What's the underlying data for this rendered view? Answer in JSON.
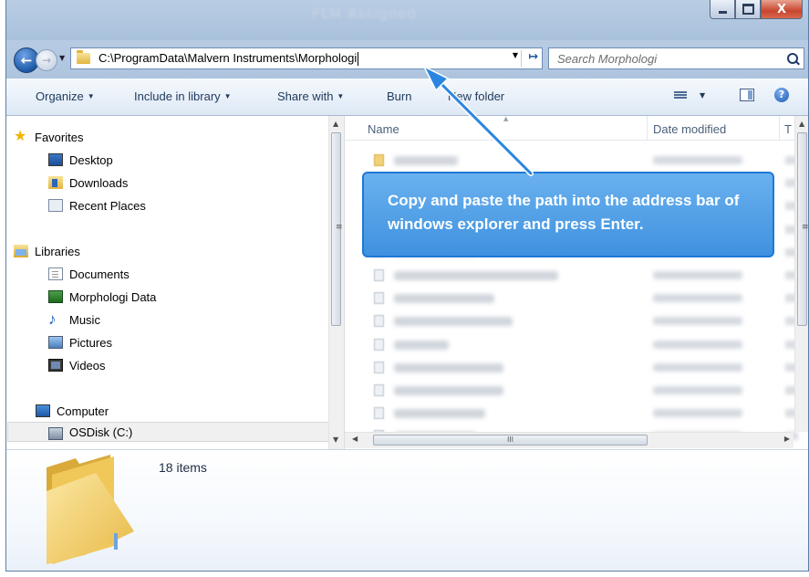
{
  "window": {
    "title": "PLM Assigned",
    "controls": {
      "minimize": "minimize",
      "maximize": "maximize",
      "close": "X"
    }
  },
  "address_bar": {
    "path": "C:\\ProgramData\\Malvern Instruments\\Morphologi",
    "search_placeholder": "Search Morphologi"
  },
  "toolbar": {
    "organize": "Organize",
    "include_in_library": "Include in library",
    "share_with": "Share with",
    "burn": "Burn",
    "new_folder": "New folder",
    "help": "?"
  },
  "nav_pane": {
    "favorites": {
      "label": "Favorites",
      "items": [
        "Desktop",
        "Downloads",
        "Recent Places"
      ]
    },
    "libraries": {
      "label": "Libraries",
      "items": [
        "Documents",
        "Morphologi Data",
        "Music",
        "Pictures",
        "Videos"
      ]
    },
    "computer": {
      "label": "Computer",
      "items": [
        "OSDisk (C:)"
      ]
    }
  },
  "content": {
    "columns": {
      "name": "Name",
      "date_modified": "Date modified",
      "type": "T"
    },
    "blurred_rows": 13,
    "scroll_grip": "III",
    "vscroll_grip": "≡"
  },
  "details": {
    "item_count": "18 items"
  },
  "annotation": {
    "text": "Copy and paste the path into the address bar of windows explorer and press Enter.",
    "color": "#3f91df"
  }
}
